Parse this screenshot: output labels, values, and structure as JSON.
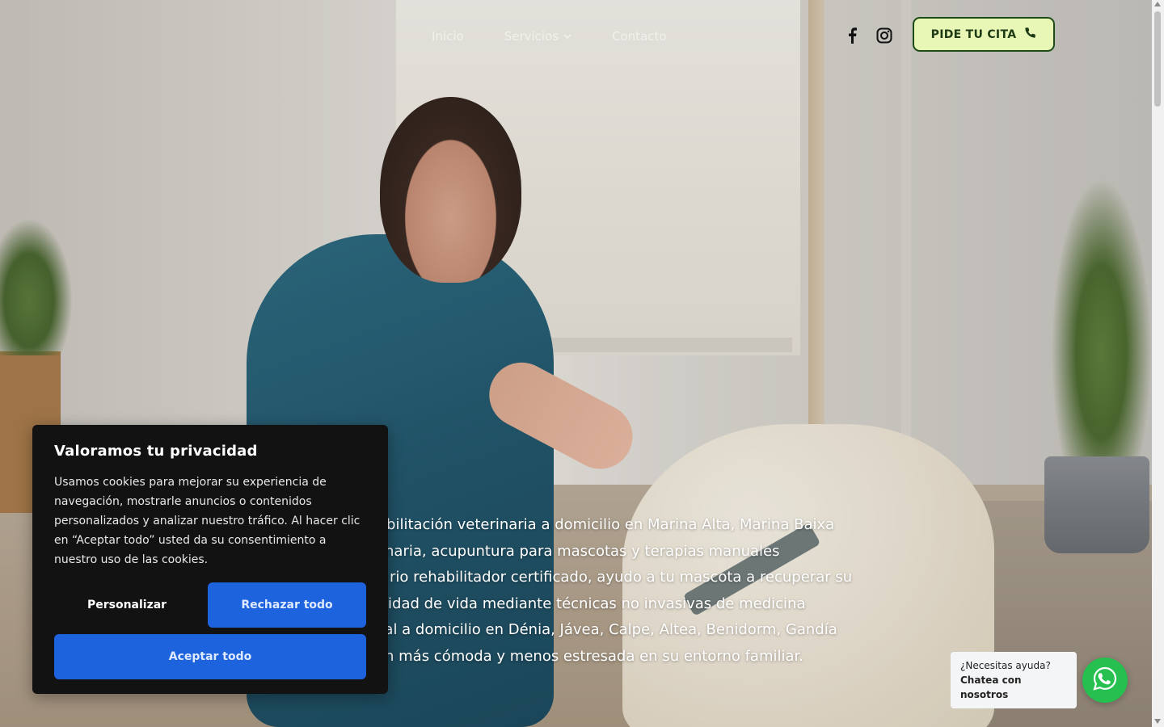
{
  "header": {
    "nav": [
      {
        "label": "Inicio"
      },
      {
        "label": "Servicios",
        "has_dropdown": true
      },
      {
        "label": "Contacto"
      }
    ],
    "social": [
      {
        "icon": "facebook-icon"
      },
      {
        "icon": "instagram-icon"
      }
    ],
    "cta_label": "PIDE TU CITA",
    "cta_icon": "phone-icon",
    "cta_bg": "#e8f7b6",
    "cta_border": "#1d4b18"
  },
  "hero": {
    "lines": [
      "abilitación veterinaria a domicilio en Marina Alta, Marina Baixa",
      "naria, acupuntura para mascotas y terapias manuales",
      "rio rehabilitador certificado, ayudo a tu mascota a recuperar su",
      "alidad de vida mediante técnicas no invasivas de medicina",
      "nal a domicilio en Dénia, Jávea, Calpe, Altea, Benidorm, Gandía",
      "n más cómoda y menos estresada en su entorno familiar."
    ]
  },
  "cookie": {
    "title": "Valoramos tu privacidad",
    "body": "Usamos cookies para mejorar su experiencia de navegación, mostrarle anuncios o contenidos personalizados y analizar nuestro tráfico. Al hacer clic en “Aceptar todo” usted da su consentimiento a nuestro uso de las cookies.",
    "customize_label": "Personalizar",
    "reject_label": "Rechazar todo",
    "accept_label": "Aceptar todo",
    "button_color": "#1e63de"
  },
  "whatsapp": {
    "question": "¿Necesitas ayuda?",
    "cta": "Chatea con nosotros",
    "icon": "whatsapp-icon",
    "color": "#25c04f"
  }
}
